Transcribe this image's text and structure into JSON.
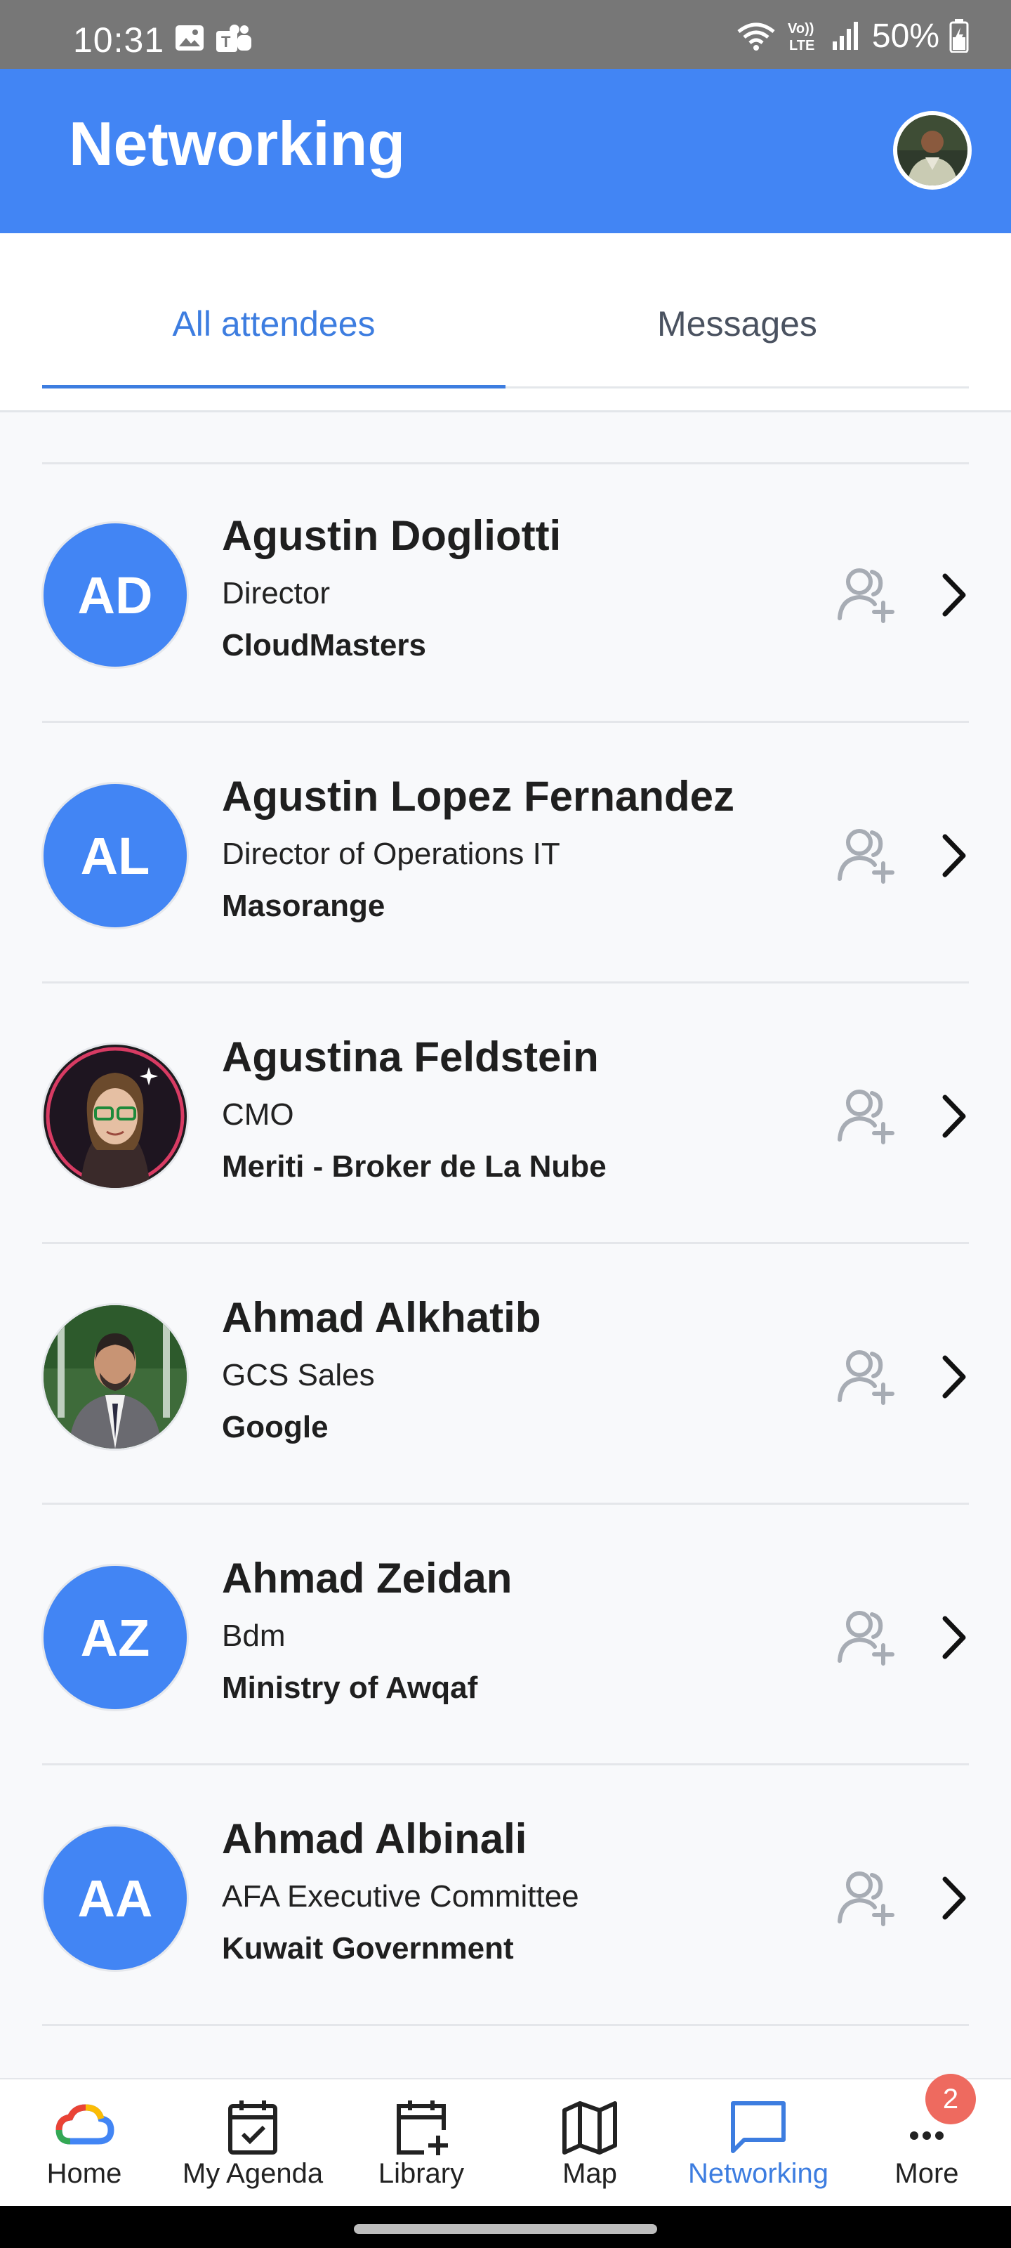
{
  "status_bar": {
    "time": "10:31",
    "battery": "50%",
    "icons": [
      "gallery-icon",
      "teams-icon",
      "wifi-icon",
      "volte-icon",
      "signal-icon",
      "battery-icon"
    ]
  },
  "header": {
    "title": "Networking",
    "avatar_icon": "profile-avatar"
  },
  "tabs": [
    {
      "label": "All attendees",
      "active": true
    },
    {
      "label": "Messages",
      "active": false
    }
  ],
  "attendees": [
    {
      "initials": "AD",
      "name": "Agustin Dogliotti",
      "role": "Director",
      "company": "CloudMasters",
      "photo": false
    },
    {
      "initials": "AL",
      "name": "Agustin Lopez Fernandez",
      "role": "Director of Operations IT",
      "company": "Masorange",
      "photo": false
    },
    {
      "initials": "",
      "name": "Agustina Feldstein",
      "role": "CMO",
      "company": "Meriti - Broker de La Nube",
      "photo": true
    },
    {
      "initials": "",
      "name": "Ahmad Alkhatib",
      "role": "GCS Sales",
      "company": "Google",
      "photo": true
    },
    {
      "initials": "AZ",
      "name": "Ahmad Zeidan",
      "role": "Bdm",
      "company": "Ministry of Awqaf",
      "photo": false
    },
    {
      "initials": "AA",
      "name": "Ahmad Albinali",
      "role": "AFA Executive Committee",
      "company": "Kuwait Government",
      "photo": false
    }
  ],
  "bottom_nav": [
    {
      "label": "Home",
      "icon": "google-cloud-icon",
      "active": false
    },
    {
      "label": "My Agenda",
      "icon": "calendar-check-icon",
      "active": false
    },
    {
      "label": "Library",
      "icon": "calendar-plus-icon",
      "active": false
    },
    {
      "label": "Map",
      "icon": "map-icon",
      "active": false
    },
    {
      "label": "Networking",
      "icon": "chat-icon",
      "active": true
    },
    {
      "label": "More",
      "icon": "more-icon",
      "active": false
    }
  ],
  "more_badge": "2",
  "colors": {
    "primary": "#4285f4",
    "tab_active": "#3d7de0",
    "badge": "#ee6a5f",
    "status_bar": "#777777"
  }
}
